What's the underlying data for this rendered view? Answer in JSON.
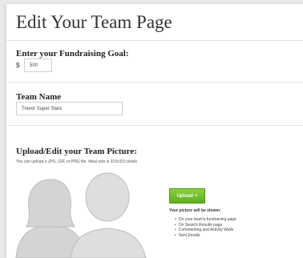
{
  "page": {
    "title": "Edit Your Team Page"
  },
  "goal": {
    "label": "Enter your Fundraising Goal:",
    "currency": "$",
    "value": "500"
  },
  "team": {
    "label": "Team Name",
    "value": "Trevor Super Stars"
  },
  "picture": {
    "label": "Upload/Edit your Team Picture:",
    "hint": "You can upload a JPG, GIF, or PNG file. Ideal size is 315x315 pixels",
    "upload_label": "Upload",
    "upload_icon": "plus-icon",
    "shown_title": "Your picture will be shown:",
    "uses": [
      "On your team's fundraising page",
      "On Search Results page",
      "Commenting and Activity Walls",
      "Sent Emails"
    ]
  },
  "colors": {
    "button_green": "#6cbe2a",
    "text": "#333333"
  }
}
